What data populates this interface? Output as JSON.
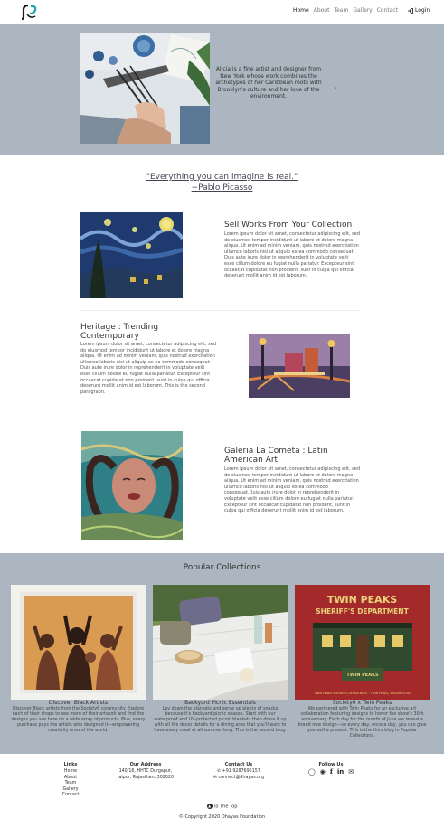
{
  "nav": {
    "links": [
      "Home",
      "About",
      "Team",
      "Gallery",
      "Contact"
    ],
    "login": "Login"
  },
  "hero": {
    "text": "Alicia is a fine artist and designer from New York whose work combines the archetypes of her Caribbean roots with Brooklyn's culture and her love of the environment."
  },
  "quote": {
    "text": "\"Everything you can imagine is real.\"",
    "author": "~Pablo Picasso"
  },
  "features": [
    {
      "title": "Sell Works From Your Collection",
      "body": "Lorem ipsum dolor sit amet, consectetur adipiscing elit, sed do eiusmod tempor incididunt ut labore et dolore magna aliqua. Ut enim ad minim veniam, quis nostrud exercitation ullamco laboris nisi ut aliquip ex ea commodo consequat. Duis aute irure dolor in reprehenderit in voluptate velit esse cillum dolore eu fugiat nulla pariatur. Excepteur sint occaecat cupidatat non proident, sunt in culpa qui officia deserunt mollit anim id est laborum."
    },
    {
      "title": "Heritage : Trending Contemporary",
      "body": "Lorem ipsum dolor sit amet, consectetur adipiscing elit, sed do eiusmod tempor incididunt ut labore et dolore magna aliqua. Ut enim ad minim veniam, quis nostrud exercitation ullamco laboris nisi ut aliquip ex ea commodo consequat. Duis aute irure dolor in reprehenderit in voluptate velit esse cillum dolore eu fugiat nulla pariatur. Excepteur sint occaecat cupidatat non proident, sunt in culpa qui officia deserunt mollit anim id est laborum. This is the second paragraph."
    },
    {
      "title": "Galeria La Cometa : Latin American Art",
      "body": "Lorem ipsum dolor sit amet, consectetur adipiscing elit, sed do eiusmod tempor incididunt ut labore et dolore magna aliqua. Ut enim ad minim veniam, quis nostrud exercitation ullamco laboris nisi ut aliquip ex ea commodo consequat.Duis aute irure dolor in reprehenderit in voluptate velit esse cillum dolore eu fugiat nulla pariatur. Excepteur sint occaecat cupidatat non proident, sunt in culpa qui officia deserunt mollit anim id est laborum."
    }
  ],
  "popular": {
    "title": "Popular Collections",
    "cards": [
      {
        "title": "Discover Black Artists",
        "text": "Discover Black artists from the Society6 community. Explore each of their shops to see more of their artwork and find the designs you see here on a wide array of products. Plus, every purchase pays the artists who designed it—empowering creativity around the world."
      },
      {
        "title": "Backyard Picnic Essentials",
        "text": "Lay down the blankets and serve up plenty of snacks because it's backyard picnic season. Start with our waterproof and UV-protected picnic blankets then dress it up with all the decor details for a dining area that you'll want to have every meal at all summer long. This is the second blog."
      },
      {
        "title": "Society6 x Twin Peaks",
        "text": "We partnered with Twin Peaks for an exclusive art collaboration featuring designs to honor the show's 30th anniversary. Each day for the month of June we reveal a brand new design—so every day, once a day, you can give yourself a present. This is the third blog in Popular Collections.",
        "sign_line1": "TWIN PEAKS",
        "sign_line2": "SHERIFF'S DEPARTMENT",
        "sign_line3": "TWIN PEAKS",
        "sign_footer": "TWIN PEAKS SHERIFF'S DEPARTMENT · TWIN PEAKS, WASHINGTON"
      }
    ]
  },
  "footer": {
    "links_heading": "Links",
    "links": [
      "Home",
      "About",
      "Team",
      "Gallery",
      "Contact"
    ],
    "address_heading": "Our Address",
    "address_line1": "140/16, HHTC Durgapur,",
    "address_line2": "Jaipur, Rajasthan, 302020",
    "contact_heading": "Contact Us",
    "phone": "+91 9287695157",
    "email": "connect@dhayas.org",
    "follow_heading": "Follow Us",
    "to_top": "To The Top",
    "copyright": "© Copyright 2020 Dhayas Foundation"
  }
}
